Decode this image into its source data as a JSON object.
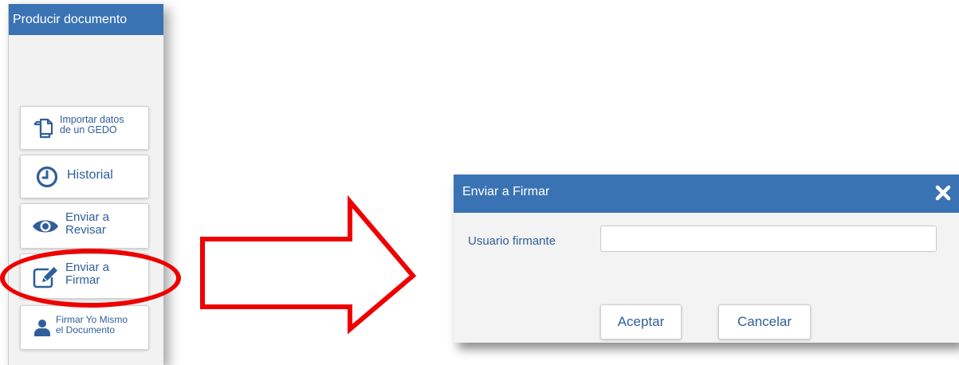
{
  "sidebar": {
    "title": "Producir documento",
    "buttons": [
      {
        "label": "Importar datos\nde un GEDO",
        "icon": "documents-icon"
      },
      {
        "label": "Historial",
        "icon": "clock-icon"
      },
      {
        "label": "Enviar a\nRevisar",
        "icon": "eye-icon"
      },
      {
        "label": "Enviar a\nFirmar",
        "icon": "edit-icon"
      },
      {
        "label": "Firmar Yo Mismo\nel Documento",
        "icon": "user-icon"
      }
    ]
  },
  "dialog": {
    "title": "Enviar a Firmar",
    "field_label": "Usuario firmante",
    "field_value": "",
    "accept_label": "Aceptar",
    "cancel_label": "Cancelar"
  },
  "colors": {
    "header_blue": "#3a73b3",
    "text_blue": "#2f5f9a",
    "annotation_red": "#ee0000"
  }
}
